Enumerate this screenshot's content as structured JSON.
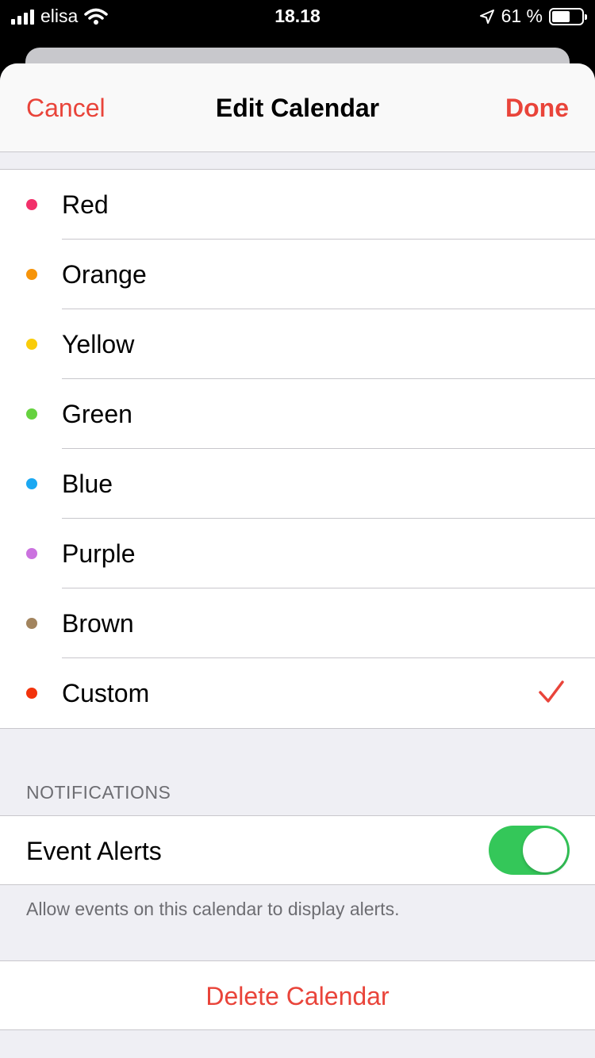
{
  "status_bar": {
    "carrier": "elisa",
    "time": "18.18",
    "battery_text": "61 %",
    "battery_level": 0.61
  },
  "nav": {
    "cancel": "Cancel",
    "title": "Edit Calendar",
    "done": "Done"
  },
  "colors": [
    {
      "label": "Red",
      "dot": "#f2306a",
      "selected": false
    },
    {
      "label": "Orange",
      "dot": "#f6940a",
      "selected": false
    },
    {
      "label": "Yellow",
      "dot": "#f9cc0a",
      "selected": false
    },
    {
      "label": "Green",
      "dot": "#66d23f",
      "selected": false
    },
    {
      "label": "Blue",
      "dot": "#1ba8f2",
      "selected": false
    },
    {
      "label": "Purple",
      "dot": "#cb72df",
      "selected": false
    },
    {
      "label": "Brown",
      "dot": "#a2845e",
      "selected": false
    },
    {
      "label": "Custom",
      "dot": "#f2330c",
      "selected": true
    }
  ],
  "notifications": {
    "header": "NOTIFICATIONS",
    "event_alerts_label": "Event Alerts",
    "event_alerts_on": true,
    "footer": "Allow events on this calendar to display alerts."
  },
  "delete_label": "Delete Calendar",
  "accent": "#e9443a",
  "toggle_on_color": "#34c759"
}
